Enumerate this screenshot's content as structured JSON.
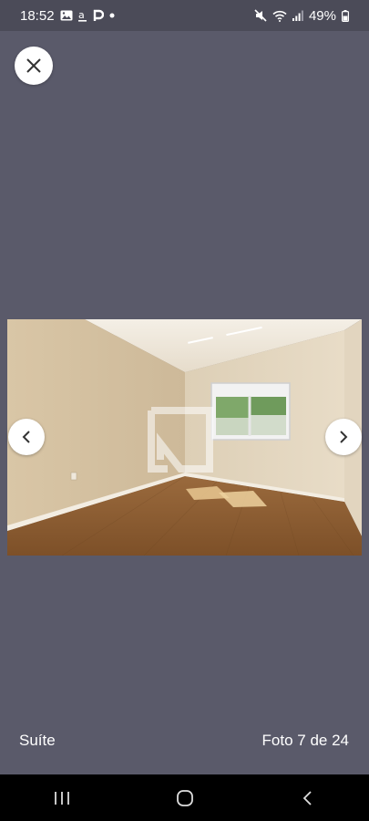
{
  "status_bar": {
    "time": "18:52",
    "left_icons": [
      "image-icon",
      "a-icon",
      "p-icon",
      "dot-icon"
    ],
    "right_icons": [
      "mute-icon",
      "wifi-icon",
      "signal-icon"
    ],
    "battery": "49%"
  },
  "viewer": {
    "close_icon": "close-icon",
    "prev_icon": "chevron-left-icon",
    "next_icon": "chevron-right-icon",
    "watermark_icon": "logo-icon"
  },
  "footer": {
    "caption": "Suíte",
    "counter": "Foto 7 de 24"
  },
  "system_nav": [
    "recents-icon",
    "home-icon",
    "back-icon"
  ]
}
